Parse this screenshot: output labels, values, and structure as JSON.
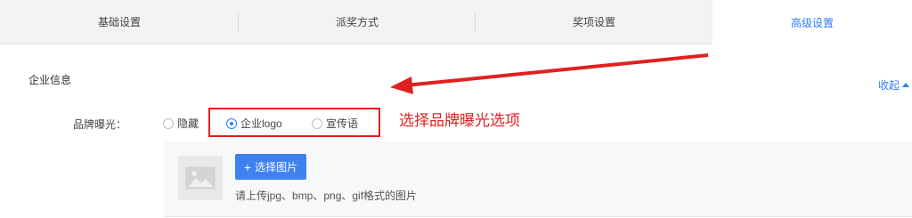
{
  "tabs": [
    {
      "label": "基础设置",
      "active": false
    },
    {
      "label": "派奖方式",
      "active": false
    },
    {
      "label": "奖项设置",
      "active": false
    },
    {
      "label": "高级设置",
      "active": true
    }
  ],
  "section": {
    "title": "企业信息",
    "collapse_label": "收起"
  },
  "brand_exposure": {
    "label": "品牌曝光：",
    "options": [
      {
        "label": "隐藏",
        "checked": false
      },
      {
        "label": "企业logo",
        "checked": true
      },
      {
        "label": "宣传语",
        "checked": false
      }
    ]
  },
  "annotation": {
    "text": "选择品牌曝光选项",
    "color": "#e02020"
  },
  "upload": {
    "button_label": "选择图片",
    "hint": "请上传jpg、bmp、png、gif格式的图片"
  },
  "colors": {
    "accent": "#2e7cf6",
    "annotation": "#e02020"
  }
}
